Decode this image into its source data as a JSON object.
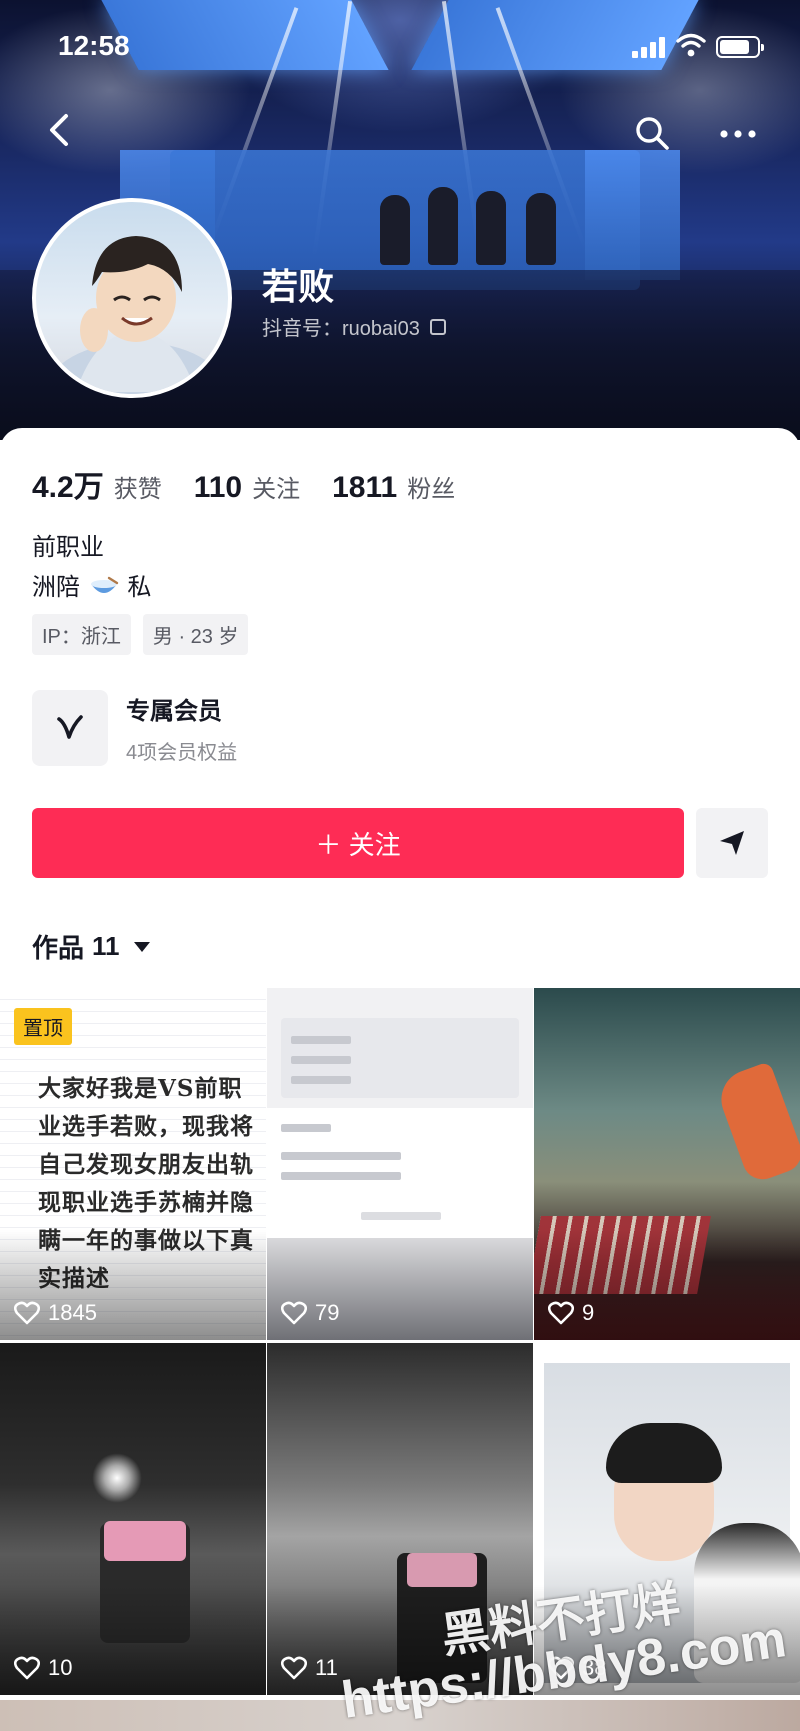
{
  "status_bar": {
    "time": "12:58",
    "battery_level": 0.8
  },
  "icons": {
    "back": "chevron-left-icon",
    "search": "search-icon",
    "more": "more-horizontal-icon",
    "copy": "copy-icon",
    "vip": "v-logo-icon",
    "share": "share-arrow-icon",
    "like": "heart-icon",
    "caret": "caret-down-icon"
  },
  "profile": {
    "name": "若败",
    "douyin_id": "抖音号：ruobai03"
  },
  "stats": [
    {
      "value": "4.2万",
      "label": "获赞"
    },
    {
      "value": "110",
      "label": "关注"
    },
    {
      "value": "1811",
      "label": "粉丝"
    }
  ],
  "bio": {
    "line1": "前职业",
    "line2_prefix": "洲陪",
    "line2_suffix": "私"
  },
  "tags": [
    "IP：浙江",
    "男 · 23 岁"
  ],
  "vip": {
    "title": "专属会员",
    "subtitle": "4项会员权益"
  },
  "actions": {
    "follow": "＋ 关注"
  },
  "works": {
    "label": "作品",
    "count": "11"
  },
  "videos": [
    {
      "likes": "1845",
      "pinned": "置顶",
      "text": "大家好我是VS前职业选手若败，现我将自己发现女朋友出轨现职业选手苏楠并隐瞒一年的事做以下真实描述"
    },
    {
      "likes": "79"
    },
    {
      "likes": "9"
    },
    {
      "likes": "10"
    },
    {
      "likes": "11"
    },
    {
      "likes": "38"
    }
  ],
  "watermark": {
    "line1": "黑料不打烊",
    "url": "https://bbdy8.com"
  },
  "colors": {
    "primary": "#fe2c55",
    "pinned": "#fac31e",
    "text": "#161823",
    "secondary": "#585a63"
  }
}
